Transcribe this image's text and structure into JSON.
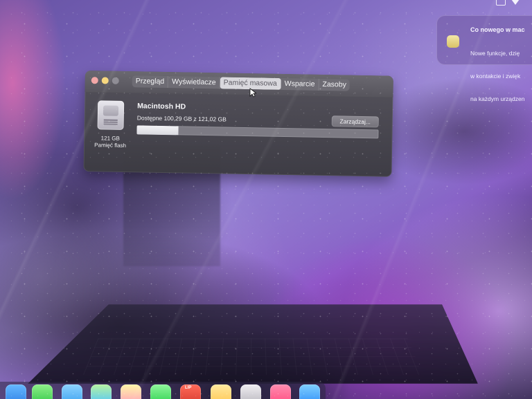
{
  "notification": {
    "title": "Co nowego w mac",
    "body_lines": [
      "Nowe funkcje, dzię",
      "w kontakcie i zwięk",
      "na każdym urządzen"
    ]
  },
  "window": {
    "tabs": [
      {
        "label": "Przegląd",
        "active": false
      },
      {
        "label": "Wyświetlacze",
        "active": false
      },
      {
        "label": "Pamięć masowa",
        "active": true
      },
      {
        "label": "Wsparcie",
        "active": false
      },
      {
        "label": "Zasoby",
        "active": false
      }
    ],
    "storage": {
      "drive_size": "121 GB",
      "drive_kind": "Pamięć flash",
      "volume_name": "Macintosh HD",
      "stats": "Dostępne 100,29 GB z 121,02 GB",
      "manage_button": "Zarządzaj...",
      "used_fraction": 0.171
    }
  },
  "dock": {
    "items": [
      {
        "name": "finder-icon",
        "label": ""
      },
      {
        "name": "messages-icon",
        "label": ""
      },
      {
        "name": "mail-icon",
        "label": ""
      },
      {
        "name": "maps-icon",
        "label": ""
      },
      {
        "name": "photos-icon",
        "label": ""
      },
      {
        "name": "facetime-icon",
        "label": ""
      },
      {
        "name": "calendar-icon",
        "label": "LIP"
      },
      {
        "name": "notes-icon",
        "label": ""
      },
      {
        "name": "settings-icon",
        "label": ""
      },
      {
        "name": "music-icon",
        "label": ""
      },
      {
        "name": "app-store-icon",
        "label": ""
      }
    ]
  }
}
